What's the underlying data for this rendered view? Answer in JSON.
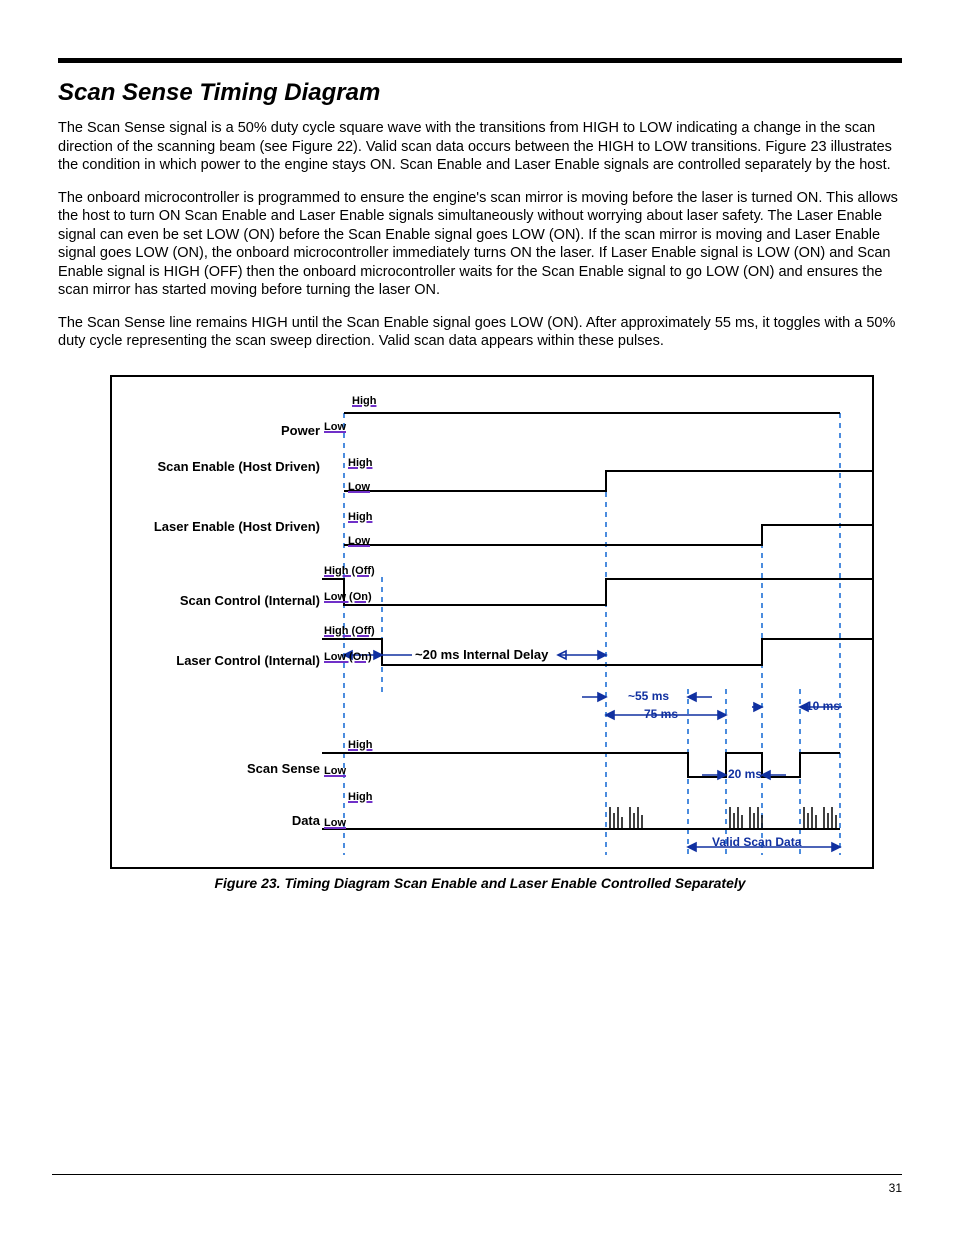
{
  "section_title": "Scan Sense Timing Diagram",
  "paragraphs": [
    "The Scan Sense signal is a 50% duty cycle square wave with the transitions from HIGH to LOW indicating a change in the scan direction of the scanning beam (see Figure 22).  Valid scan data occurs between the HIGH to LOW transitions.  Figure 23 illustrates the condition in which power to the engine stays ON.  Scan Enable and Laser Enable signals are controlled separately by the host.",
    "The onboard microcontroller is programmed to ensure the engine's scan mirror is moving before the laser is turned ON.  This allows the host to turn ON Scan Enable and Laser Enable signals simultaneously without worrying about laser safety.  The Laser Enable signal can even be set LOW (ON) before the Scan Enable signal goes LOW (ON).  If the scan mirror is moving and Laser Enable signal goes LOW (ON), the onboard microcontroller immediately turns ON the laser.  If Laser Enable signal is LOW (ON) and Scan Enable signal is HIGH (OFF) then the onboard microcontroller waits for the Scan Enable signal to go LOW (ON) and ensures the scan mirror has started moving before turning the laser ON.",
    "The Scan Sense line remains HIGH until the Scan Enable signal goes LOW (ON).  After approximately 55 ms, it toggles with a 50% duty cycle representing the scan sweep direction.  Valid scan data appears within these pulses."
  ],
  "figure_caption": "Figure 23. Timing Diagram Scan Enable and Laser Enable Controlled Separately",
  "page_number": "31",
  "chart_data": {
    "type": "timing-diagram",
    "signals": [
      {
        "name": "Power",
        "levels": [
          "High",
          "Low"
        ],
        "trace": "constant HIGH"
      },
      {
        "name": "Scan Enable (Host Driven)",
        "levels": [
          "High",
          "Low"
        ],
        "trace": "LOW until t1, then HIGH"
      },
      {
        "name": "Laser Enable (Host Driven)",
        "levels": [
          "High",
          "Low"
        ],
        "trace": "LOW until t3, then HIGH"
      },
      {
        "name": "Scan Control (Internal)",
        "levels": [
          "High (Off)",
          "Low (On)"
        ],
        "trace": "HIGH (Off) at start, LOW (On) shortly after, back HIGH (Off) at t1"
      },
      {
        "name": "Laser Control (Internal)",
        "levels": [
          "High (Off)",
          "Low (On)"
        ],
        "trace": "HIGH (Off), LOW (On) after ~20 ms delay from Scan Control LOW, back HIGH (Off) at t3"
      },
      {
        "name": "Scan Sense",
        "levels": [
          "High",
          "Low"
        ],
        "trace": "HIGH ~55 ms after Scan Enable LOW, then 50% duty-cycle square wave"
      },
      {
        "name": "Data",
        "levels": [
          "High",
          "Low"
        ],
        "trace": "LOW baseline; high-frequency pulse bursts inside each Scan Sense HIGH window (Valid Scan Data)"
      }
    ],
    "annotations": {
      "internal_delay": "~20 ms Internal Delay",
      "scan_sense_first_delay": "~55 ms",
      "scan_sense_period": "75 ms",
      "scan_sense_high": "20 ms",
      "scan_sense_gap": "10 ms",
      "valid_scan_data": "Valid Scan Data"
    }
  }
}
